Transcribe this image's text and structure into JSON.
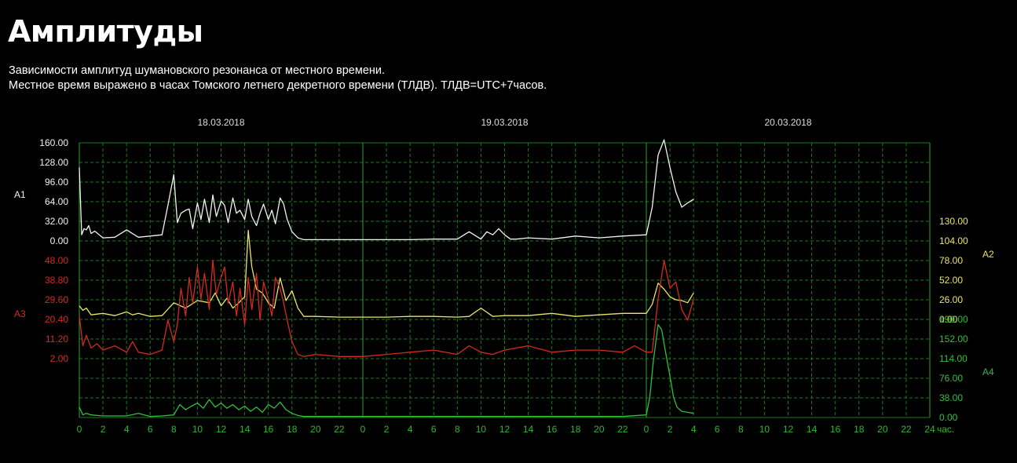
{
  "page": {
    "title": "Амплитуды",
    "description_line1": "Зависимости амплитуд шумановского резонанса от местного времени.",
    "description_line2": "Местное время выражено в часах Томского летнего декретного времени (ТЛДВ). ТЛДВ=UTC+7часов."
  },
  "colors": {
    "background": "#000000",
    "grid": "#1d7a1d",
    "grid_dashed": "#1f6a1f",
    "day_separator": "#2fa42f",
    "axis_text": "#2eb82e",
    "a1": "#f2f2f2",
    "a2": "#e8e56a",
    "a3": "#d42a1f",
    "a4": "#2ec03a"
  },
  "chart_data": {
    "type": "line",
    "dates": [
      "18.03.2018",
      "19.03.2018",
      "20.03.2018"
    ],
    "x_unit": "час.",
    "x_tick_labels": [
      "0",
      "2",
      "4",
      "6",
      "8",
      "10",
      "12",
      "14",
      "16",
      "18",
      "20",
      "22",
      "0",
      "2",
      "4",
      "6",
      "8",
      "10",
      "12",
      "14",
      "16",
      "18",
      "20",
      "22",
      "0",
      "2",
      "4",
      "6",
      "8",
      "10",
      "12",
      "14",
      "16",
      "18",
      "20",
      "22",
      "24"
    ],
    "xlim": [
      0,
      72
    ],
    "grid": true,
    "axes": {
      "A1": {
        "label": "A1",
        "side": "left",
        "ticks": [
          "160.00",
          "128.00",
          "96.00",
          "64.00",
          "32.00",
          "0.00"
        ],
        "ylim": [
          0,
          160
        ]
      },
      "A2": {
        "label": "A2",
        "side": "right",
        "ticks": [
          "130.00",
          "104.00",
          "78.00",
          "52.00",
          "26.00",
          "0.00"
        ],
        "ylim": [
          0,
          130
        ]
      },
      "A3": {
        "label": "A3",
        "side": "left",
        "ticks": [
          "48.00",
          "38.80",
          "29.60",
          "20.40",
          "11.20",
          "2.00"
        ],
        "ylim": [
          2,
          48
        ]
      },
      "A4": {
        "label": "A4",
        "side": "right",
        "ticks": [
          "190.00",
          "152.00",
          "114.00",
          "76.00",
          "38.00",
          "0.00"
        ],
        "ylim": [
          0,
          190
        ]
      }
    },
    "series": [
      {
        "name": "A1",
        "axis": "A1",
        "x": [
          0,
          0.2,
          0.4,
          0.6,
          0.8,
          1,
          1.3,
          2,
          3,
          4,
          5,
          6,
          7,
          7.5,
          8,
          8.3,
          8.6,
          9,
          9.3,
          9.6,
          10,
          10.3,
          10.6,
          11,
          11.3,
          11.6,
          12,
          12.3,
          12.6,
          13,
          13.3,
          13.6,
          14,
          14.3,
          14.6,
          15,
          15.3,
          15.6,
          16,
          16.3,
          16.6,
          17,
          17.3,
          17.6,
          18,
          18.5,
          19,
          20,
          22,
          24,
          26,
          28,
          30,
          32,
          33,
          34,
          34.5,
          35,
          35.5,
          36,
          36.5,
          37,
          38,
          40,
          42,
          44,
          46,
          48,
          48.5,
          49,
          49.5,
          50,
          50.5,
          51,
          51.5,
          52
        ],
        "y": [
          120,
          10,
          20,
          18,
          25,
          12,
          16,
          5,
          6,
          18,
          6,
          8,
          10,
          58,
          108,
          30,
          45,
          50,
          52,
          20,
          62,
          35,
          68,
          30,
          75,
          40,
          65,
          58,
          30,
          70,
          45,
          50,
          35,
          68,
          40,
          25,
          45,
          60,
          35,
          50,
          28,
          70,
          60,
          35,
          15,
          5,
          2,
          2,
          2,
          2,
          2,
          2,
          3,
          3,
          15,
          3,
          15,
          10,
          20,
          10,
          3,
          3,
          5,
          3,
          8,
          5,
          8,
          10,
          55,
          140,
          165,
          120,
          80,
          55,
          62,
          68
        ]
      },
      {
        "name": "A2",
        "axis": "A2",
        "x": [
          0,
          0.3,
          0.6,
          1,
          2,
          3,
          4,
          4.5,
          5,
          6,
          7,
          8,
          9,
          10,
          11,
          11.5,
          12,
          12.5,
          13,
          13.5,
          14,
          14.3,
          14.6,
          15,
          15.5,
          16,
          16.5,
          17,
          17.5,
          18,
          18.5,
          19,
          20,
          22,
          24,
          26,
          28,
          30,
          32,
          33,
          34,
          35,
          36,
          38,
          40,
          42,
          44,
          46,
          48,
          48.5,
          49,
          49.5,
          50,
          50.5,
          51,
          51.5,
          52
        ],
        "y": [
          18,
          12,
          15,
          6,
          8,
          5,
          10,
          6,
          8,
          4,
          5,
          22,
          15,
          25,
          22,
          35,
          18,
          28,
          15,
          22,
          30,
          118,
          70,
          40,
          35,
          22,
          15,
          55,
          25,
          38,
          15,
          4,
          4,
          3,
          3,
          3,
          4,
          4,
          3,
          4,
          15,
          4,
          5,
          5,
          8,
          4,
          6,
          8,
          8,
          20,
          48,
          40,
          30,
          26,
          25,
          22,
          35
        ]
      },
      {
        "name": "A3",
        "axis": "A3",
        "x": [
          0,
          0.3,
          0.6,
          1,
          1.5,
          2,
          3,
          4,
          4.5,
          5,
          6,
          7,
          7.5,
          8,
          8.3,
          8.6,
          9,
          9.3,
          9.6,
          10,
          10.3,
          10.6,
          11,
          11.3,
          11.6,
          12,
          12.3,
          12.6,
          13,
          13.3,
          13.6,
          14,
          14.3,
          14.6,
          15,
          15.3,
          15.6,
          16,
          16.3,
          16.6,
          17,
          17.3,
          17.6,
          18,
          18.5,
          19,
          20,
          22,
          24,
          26,
          28,
          30,
          32,
          33,
          34,
          35,
          36,
          38,
          40,
          42,
          44,
          46,
          47,
          48,
          48.5,
          49,
          49.5,
          50,
          50.5,
          51,
          51.5,
          52
        ],
        "y": [
          22,
          8,
          13,
          7,
          9,
          6,
          8,
          5,
          10,
          5,
          4,
          6,
          20,
          10,
          18,
          35,
          22,
          40,
          28,
          45,
          30,
          42,
          25,
          48,
          32,
          40,
          45,
          28,
          38,
          22,
          35,
          18,
          40,
          25,
          42,
          20,
          38,
          30,
          22,
          40,
          35,
          28,
          20,
          10,
          4,
          3,
          4,
          3,
          3,
          4,
          5,
          6,
          4,
          8,
          5,
          4,
          6,
          8,
          5,
          6,
          6,
          5,
          8,
          5,
          5,
          30,
          48,
          35,
          38,
          25,
          20,
          30
        ]
      },
      {
        "name": "A4",
        "axis": "A4",
        "x": [
          0,
          0.3,
          0.6,
          1,
          2,
          3,
          4,
          5,
          6,
          7,
          8,
          8.5,
          9,
          9.5,
          10,
          10.5,
          11,
          11.5,
          12,
          12.5,
          13,
          13.5,
          14,
          14.5,
          15,
          15.5,
          16,
          16.5,
          17,
          17.5,
          18,
          18.5,
          19,
          20,
          22,
          24,
          26,
          28,
          30,
          32,
          34,
          36,
          38,
          40,
          42,
          44,
          46,
          48,
          48.3,
          48.6,
          49,
          49.3,
          49.6,
          50,
          50.3,
          50.6,
          51,
          51.5,
          52
        ],
        "y": [
          20,
          5,
          8,
          5,
          3,
          3,
          3,
          8,
          2,
          3,
          5,
          25,
          15,
          22,
          28,
          18,
          35,
          20,
          28,
          18,
          25,
          15,
          22,
          12,
          20,
          10,
          25,
          18,
          30,
          15,
          8,
          4,
          2,
          2,
          2,
          2,
          2,
          2,
          2,
          2,
          2,
          2,
          2,
          2,
          2,
          2,
          2,
          5,
          40,
          110,
          180,
          170,
          130,
          80,
          40,
          20,
          12,
          10,
          8
        ]
      }
    ]
  }
}
